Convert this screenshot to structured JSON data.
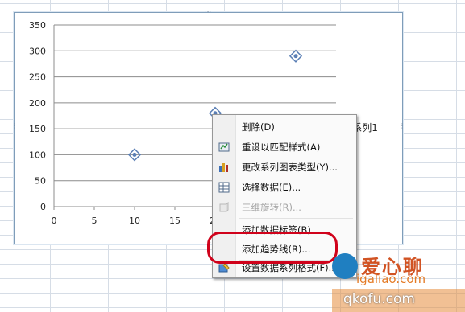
{
  "chart_data": {
    "type": "scatter",
    "series": [
      {
        "name": "系列1",
        "x": [
          10,
          20,
          30
        ],
        "y": [
          100,
          180,
          290
        ]
      }
    ],
    "xlim": [
      0,
      35
    ],
    "ylim": [
      0,
      350
    ],
    "x_ticks": [
      "0",
      "5",
      "10",
      "15",
      "20"
    ],
    "y_ticks": [
      "0",
      "50",
      "100",
      "150",
      "200",
      "250",
      "300",
      "350"
    ],
    "grid": "horizontal",
    "legend_position": "right"
  },
  "context_menu": {
    "items": [
      {
        "label": "删除(D)",
        "icon": "none",
        "enabled": true
      },
      {
        "label": "重设以匹配样式(A)",
        "icon": "reset-style-icon",
        "enabled": true
      },
      {
        "label": "更改系列图表类型(Y)...",
        "icon": "bar-chart-icon",
        "enabled": true
      },
      {
        "label": "选择数据(E)...",
        "icon": "select-data-icon",
        "enabled": true
      },
      {
        "label": "三维旋转(R)...",
        "icon": "rotate-3d-icon",
        "enabled": false
      },
      {
        "label": "添加数据标签(B)",
        "icon": "none",
        "enabled": true
      },
      {
        "label": "添加趋势线(R)...",
        "icon": "none",
        "enabled": true
      },
      {
        "label": "设置数据系列格式(F)...",
        "icon": "format-series-icon",
        "enabled": true
      }
    ]
  },
  "watermark": {
    "main": "爱心聊",
    "sub": "igaliao.com",
    "footer": "qkofu.com"
  },
  "colors": {
    "marker": "#5b7fb5",
    "highlight": "#d0021b",
    "grid": "#d6dde6"
  }
}
